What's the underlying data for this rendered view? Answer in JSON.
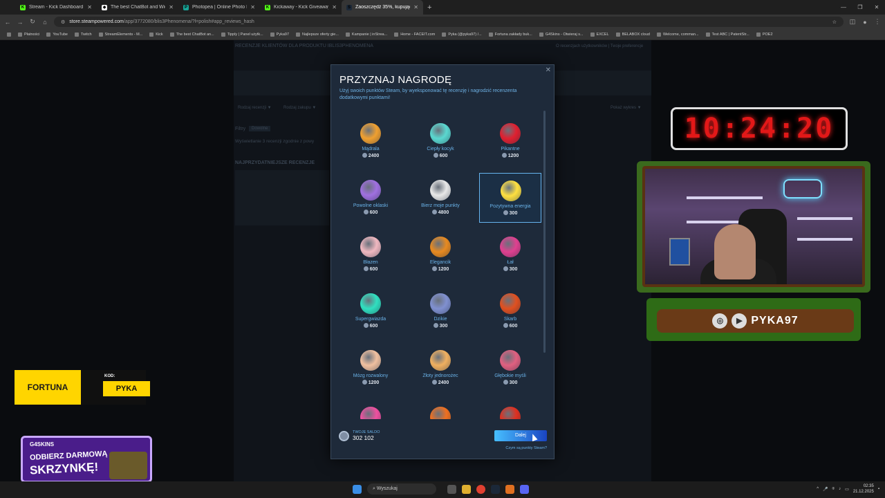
{
  "browser": {
    "tabs": [
      {
        "label": "Stream - Kick Dashboard",
        "color": "#53fc18",
        "icon": "K",
        "active": false
      },
      {
        "label": "The best ChatBot and Widget",
        "color": "#ffffff",
        "icon": "◆",
        "active": false
      },
      {
        "label": "Photopea | Online Photo Editor",
        "color": "#18a497",
        "icon": "P",
        "active": false
      },
      {
        "label": "Kickaway - Kick Giveaway Tool",
        "color": "#53fc18",
        "icon": "K",
        "active": false
      },
      {
        "label": "Zaoszczędź 35%, kupując ibis",
        "color": "#1b2838",
        "icon": "S",
        "active": true
      }
    ],
    "url_domain": "store.steampowered.com",
    "url_path": "/app/3772080/blis3Phenomena/?l=polish#app_reviews_hash",
    "bookmarks": [
      "Płatności",
      "YouTube",
      "Twitch",
      "StreamElements - M...",
      "Kick",
      "The best ChatBot an...",
      "Tipply | Panel użytk...",
      "Pyka97",
      "Najlepsze oferty gie...",
      "Kampanie | inStrea...",
      "Home - FACEIT.com",
      "Pyka (@pyka97) /...",
      "Fortuna zakłady buk...",
      "G4Skins - Otwieraj s...",
      "EXCEL",
      "BELABOX cloud",
      "Welcome, comman...",
      "Test ABC | PatentStr...",
      "POE2"
    ]
  },
  "steam_page": {
    "heading": "RECENZJE KLIENTÓW DLA PRODUKTU IBLIS3PHENOMENA",
    "heading_links": "O recenzjach użytkowników | Twoje preferencje",
    "filter1": "Rodzaj recenzji ▼",
    "filter2": "Rodzaj zakupu ▼",
    "filter_right": "Pokaż wykres ▼",
    "filters_label": "Filtry",
    "filters_chip": "Dowolne",
    "showing": "Wyświetlanie 3 recenzji zgodnie z powy",
    "most_helpful": "NAJPRZYDATNIEJSZE RECENZJE"
  },
  "modal": {
    "title": "PRZYZNAJ NAGRODĘ",
    "subtitle": "Użyj swoich punktów Steam, by wyeksponować tę recenzję i nagrodzić recenzenta dodatkowymi punktami!",
    "awards": [
      {
        "name": "Mądrala",
        "cost": "2400",
        "color": "#f0a030",
        "selected": false
      },
      {
        "name": "Ciepły kocyk",
        "cost": "600",
        "color": "#5ad8d0",
        "selected": false
      },
      {
        "name": "Pikantne",
        "cost": "1200",
        "color": "#e02030",
        "selected": false
      },
      {
        "name": "Powolne oklaski",
        "cost": "600",
        "color": "#a070e0",
        "selected": false
      },
      {
        "name": "Bierz moje punkty",
        "cost": "4800",
        "color": "#e8e8e8",
        "selected": false
      },
      {
        "name": "Pozytywna energia",
        "cost": "300",
        "color": "#ffe040",
        "selected": true
      },
      {
        "name": "Błazen",
        "cost": "600",
        "color": "#f0b8c0",
        "selected": false
      },
      {
        "name": "Elegancik",
        "cost": "1200",
        "color": "#e88a20",
        "selected": false
      },
      {
        "name": "Łał",
        "cost": "300",
        "color": "#e04090",
        "selected": false
      },
      {
        "name": "Supergwiazda",
        "cost": "600",
        "color": "#30e0c0",
        "selected": false
      },
      {
        "name": "Dzikie",
        "cost": "300",
        "color": "#8090d0",
        "selected": false
      },
      {
        "name": "Skarb",
        "cost": "600",
        "color": "#e05020",
        "selected": false
      },
      {
        "name": "Mózg rozwalony",
        "cost": "1200",
        "color": "#f0c0a0",
        "selected": false
      },
      {
        "name": "Złoty jednorożec",
        "cost": "2400",
        "color": "#f0b060",
        "selected": false
      },
      {
        "name": "Głębokie myśli",
        "cost": "300",
        "color": "#e06080",
        "selected": false
      },
      {
        "name": "",
        "cost": "",
        "color": "#f050a0",
        "selected": false
      },
      {
        "name": "",
        "cost": "",
        "color": "#f07020",
        "selected": false
      },
      {
        "name": "",
        "cost": "",
        "color": "#e03020",
        "selected": false
      }
    ],
    "balance_label": "TWOJE SALDO",
    "balance_value": "302 102",
    "next_button": "Dalej",
    "what_link": "Czym są punkty Steam?"
  },
  "overlay": {
    "clock": "10:24:20",
    "channel_name": "PYKA97",
    "fortuna_brand": "FORTUNA",
    "fortuna_code_label": "KOD:",
    "fortuna_code": "PYKA",
    "g4_brand": "G4SKINS",
    "g4_line1": "ODBIERZ DARMOWĄ",
    "g4_line2": "SKRZYNKĘ!"
  },
  "taskbar": {
    "search": "Wyszukaj",
    "time": "02:35",
    "date": "21.12.2025"
  }
}
